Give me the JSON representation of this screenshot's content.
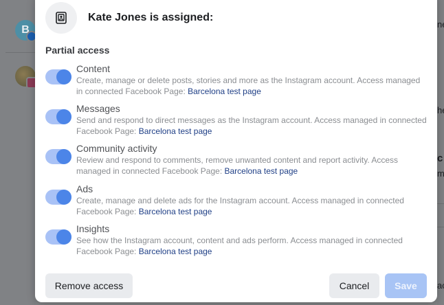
{
  "background": {
    "avatar_letter": "B",
    "right_fragments": [
      "ne",
      "he",
      "c",
      "m",
      "ac"
    ]
  },
  "modal": {
    "title": "Kate Jones is assigned:",
    "header_icon": "id-badge-icon",
    "section_title": "Partial access",
    "permissions": [
      {
        "name": "Content",
        "description": "Create, manage or delete posts, stories and more as the Instagram account. Access managed in connected Facebook Page: ",
        "link": "Barcelona test page",
        "enabled": true
      },
      {
        "name": "Messages",
        "description": "Send and respond to direct messages as the Instagram account. Access managed in connected Facebook Page: ",
        "link": "Barcelona test page",
        "enabled": true
      },
      {
        "name": "Community activity",
        "description": "Review and respond to comments, remove unwanted content and report activity. Access managed in connected Facebook Page: ",
        "link": "Barcelona test page",
        "enabled": true
      },
      {
        "name": "Ads",
        "description": "Create, manage and delete ads for the Instagram account. Access managed in connected Facebook Page: ",
        "link": "Barcelona test page",
        "enabled": true
      },
      {
        "name": "Insights",
        "description": "See how the Instagram account, content and ads perform. Access managed in connected Facebook Page: ",
        "link": "Barcelona test page",
        "enabled": true
      }
    ],
    "buttons": {
      "remove": "Remove access",
      "cancel": "Cancel",
      "save": "Save"
    }
  },
  "colors": {
    "toggle_on": "#4c85e8",
    "link": "#1f3f86",
    "save_disabled": "#a8c4f5"
  }
}
